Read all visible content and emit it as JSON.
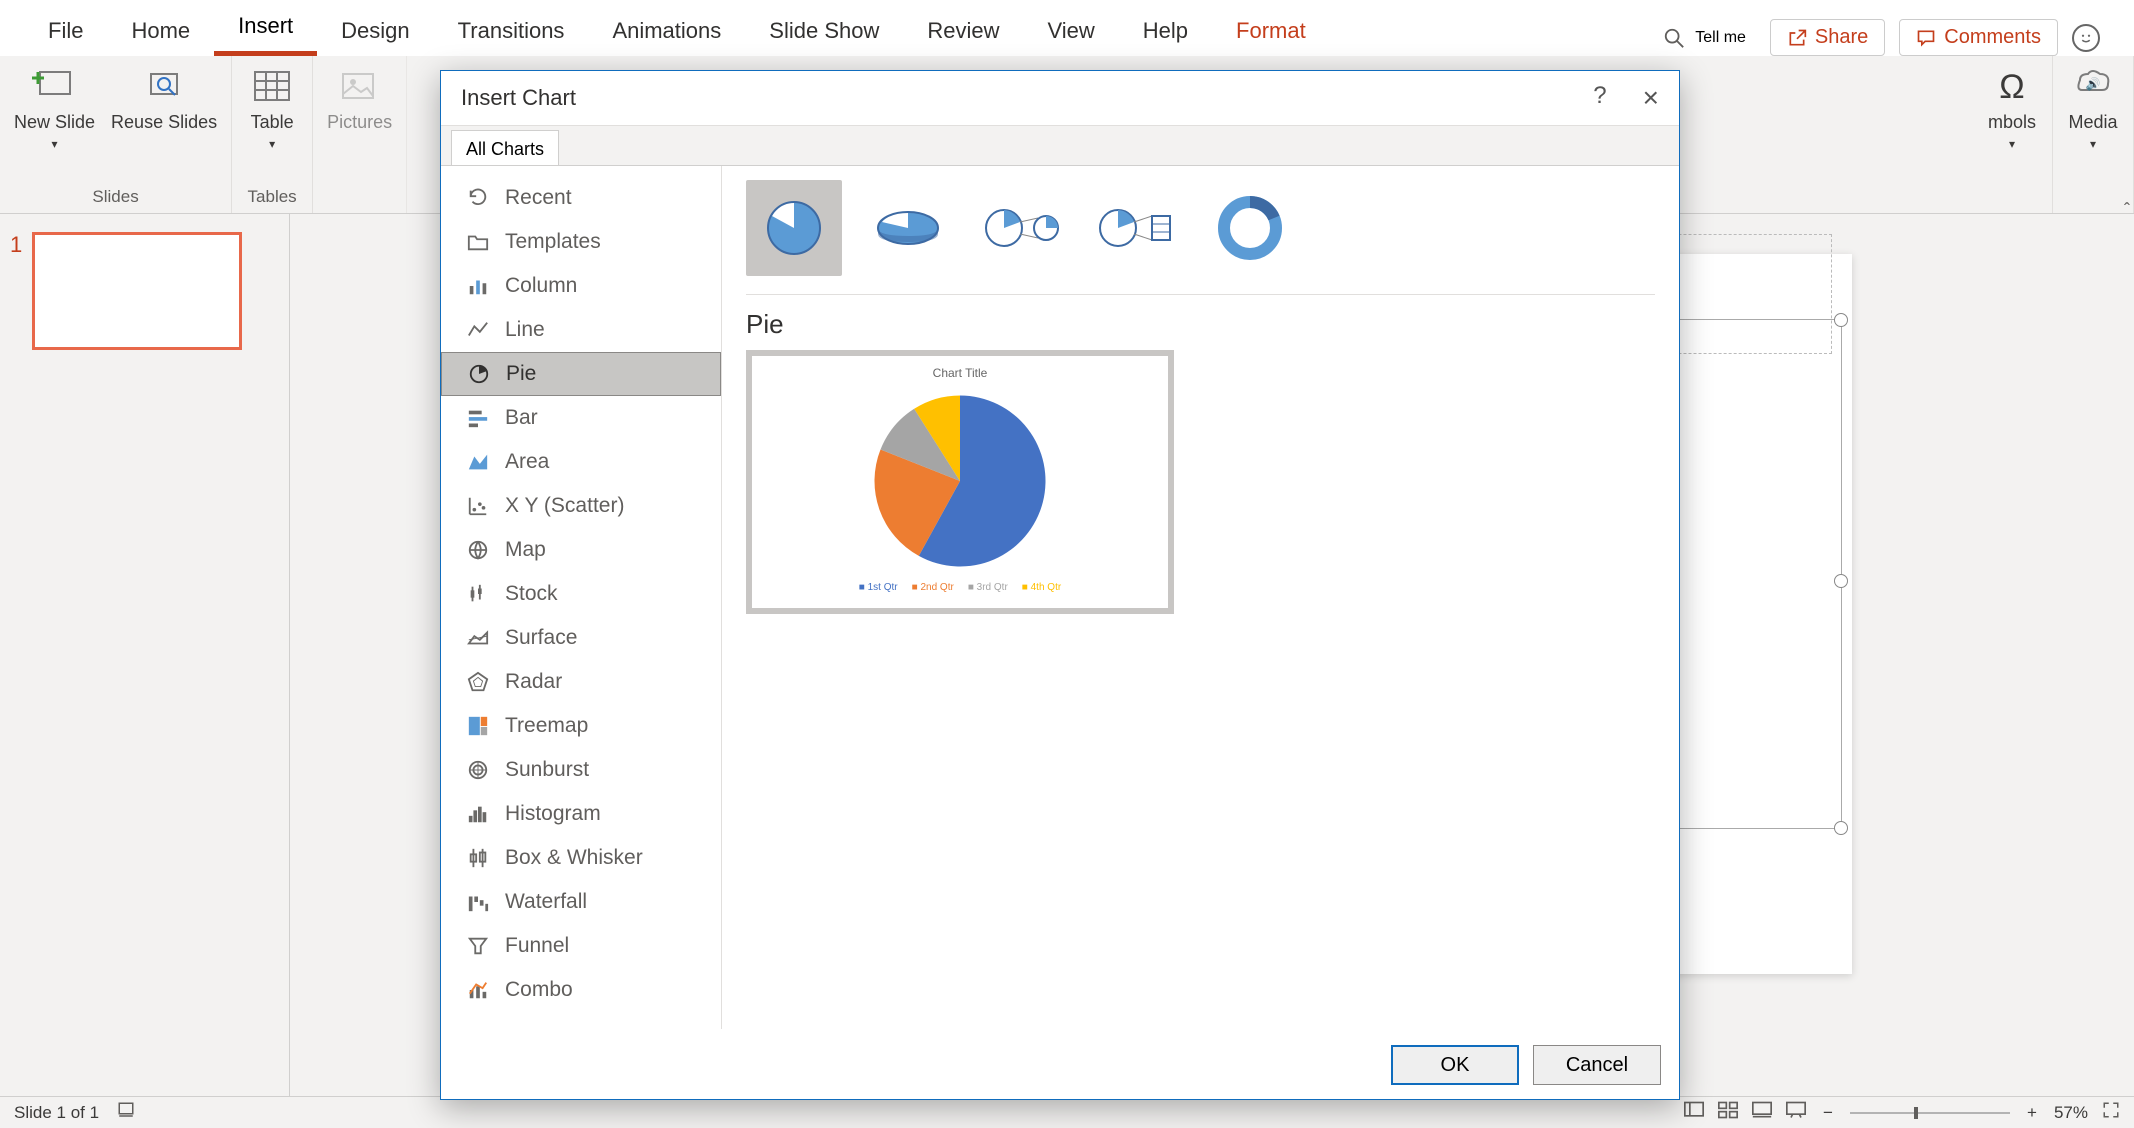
{
  "ribbon": {
    "tabs": [
      "File",
      "Home",
      "Insert",
      "Design",
      "Transitions",
      "Animations",
      "Slide Show",
      "Review",
      "View",
      "Help",
      "Format"
    ],
    "active_tab": "Insert",
    "tellme_placeholder": "Tell me",
    "share_label": "Share",
    "comments_label": "Comments",
    "groups": {
      "slides": {
        "label": "Slides",
        "new_slide": "New Slide",
        "reuse_slides": "Reuse Slides"
      },
      "tables": {
        "label": "Tables",
        "table": "Table"
      },
      "images": {
        "label": "",
        "pictures": "Pictures"
      },
      "symbols": {
        "label": "",
        "symbols": "mbols"
      },
      "media": {
        "label": "",
        "media": "Media"
      }
    }
  },
  "thumbs": {
    "slide1_index": "1"
  },
  "statusbar": {
    "slide_of": "Slide 1 of 1",
    "zoom_pct": "57%"
  },
  "dialog": {
    "title": "Insert Chart",
    "help_icon": "?",
    "close_icon": "×",
    "tab_label": "All Charts",
    "nav_items": [
      "Recent",
      "Templates",
      "Column",
      "Line",
      "Pie",
      "Bar",
      "Area",
      "X Y (Scatter)",
      "Map",
      "Stock",
      "Surface",
      "Radar",
      "Treemap",
      "Sunburst",
      "Histogram",
      "Box & Whisker",
      "Waterfall",
      "Funnel",
      "Combo"
    ],
    "nav_selected": "Pie",
    "section_title": "Pie",
    "preview_title": "Chart Title",
    "legend": [
      "1st Qtr",
      "2nd Qtr",
      "3rd Qtr",
      "4th Qtr"
    ],
    "ok_label": "OK",
    "cancel_label": "Cancel"
  },
  "chart_data": {
    "type": "pie",
    "title": "Chart Title",
    "categories": [
      "1st Qtr",
      "2nd Qtr",
      "3rd Qtr",
      "4th Qtr"
    ],
    "values": [
      58,
      23,
      10,
      9
    ],
    "colors": [
      "#4472c4",
      "#ed7d31",
      "#a5a5a5",
      "#ffc000"
    ]
  }
}
